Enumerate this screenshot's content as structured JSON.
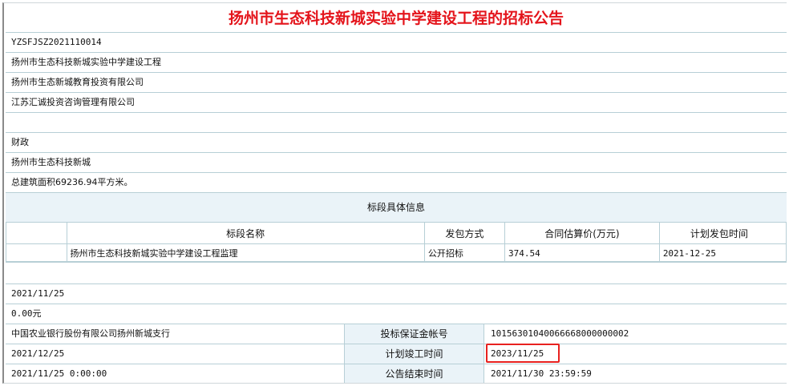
{
  "title": "扬州市生态科技新城实验中学建设工程的招标公告",
  "info_rows": [
    "YZSFJSZ2021110014",
    "扬州市生态科技新城实验中学建设工程",
    "扬州市生态新城教育投资有限公司",
    "江苏汇诚投资咨询管理有限公司",
    "",
    "财政",
    "扬州市生态科技新城",
    "总建筑面积69236.94平方米。"
  ],
  "section_header": "标段具体信息",
  "table": {
    "columns": [
      "",
      "标段名称",
      "发包方式",
      "合同估算价(万元)",
      "计划发包时间"
    ],
    "rows": [
      [
        "",
        "扬州市生态科技新城实验中学建设工程监理",
        "公开招标",
        "374.54",
        "2021-12-25"
      ]
    ]
  },
  "lower_rows": [
    "",
    "2021/11/25",
    "0.00元"
  ],
  "detail_rows": [
    {
      "left": "中国农业银行股份有限公司扬州新城支行",
      "label": "投标保证金帐号",
      "value": "10156301040066668000000002"
    },
    {
      "left": "2021/12/25",
      "label": "计划竣工时间",
      "value": "2023/11/25"
    },
    {
      "left": "2021/11/25 0:00:00",
      "label": "公告结束时间",
      "value": "2021/11/30 23:59:59"
    }
  ],
  "colors": {
    "title": "#e4141b",
    "highlight": "#e8211f",
    "header_bg": "#eaf3f8"
  }
}
